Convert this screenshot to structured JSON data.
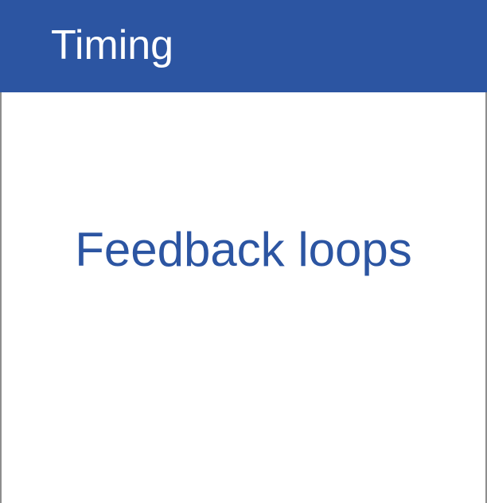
{
  "card": {
    "title": "Timing",
    "content": "Feedback loops"
  },
  "colors": {
    "header_bg": "#2c55a2",
    "header_text": "#ffffff",
    "content_text": "#2c55a2",
    "border": "#8e8e8e"
  }
}
